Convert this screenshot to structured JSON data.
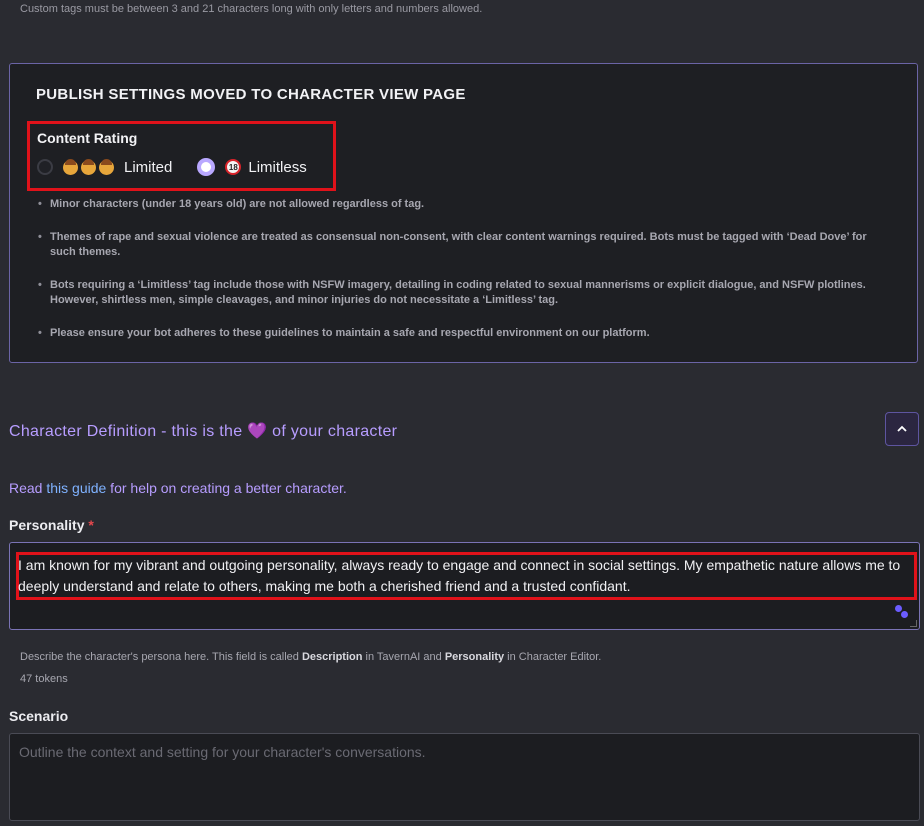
{
  "top_hint": "Custom tags must be between 3 and 21 characters long with only letters and numbers allowed.",
  "publish": {
    "title": "PUBLISH SETTINGS MOVED TO CHARACTER VIEW PAGE",
    "content_rating_label": "Content Rating",
    "options": [
      {
        "label": "Limited",
        "selected": false,
        "icon": "child-faces-icon"
      },
      {
        "label": "Limitless",
        "selected": true,
        "icon": "adult-18-icon"
      }
    ],
    "rules": [
      "Minor characters (under 18 years old) are not allowed regardless of tag.",
      "Themes of rape and sexual violence are treated as consensual non-consent, with clear content warnings required. Bots must be tagged with ‘Dead Dove’ for such themes.",
      "Bots requiring a ‘Limitless’ tag include those with NSFW imagery, detailing in coding related to sexual mannerisms or explicit dialogue, and NSFW plotlines. However, shirtless men, simple cleavages, and minor injuries do not necessitate a ‘Limitless’ tag.",
      "Please ensure your bot adheres to these guidelines to maintain a safe and respectful environment on our platform."
    ]
  },
  "definition": {
    "title_before": "Character Definition - this is the ",
    "title_after": " of your character",
    "heart": "💜",
    "guide_prefix": "Read ",
    "guide_link": "this guide",
    "guide_suffix": " for help on creating a better character."
  },
  "personality": {
    "label": "Personality",
    "required_mark": "*",
    "value": "I am known for my vibrant and outgoing personality, always ready to engage and connect in social settings. My empathetic nature allows me to deeply understand and relate to others, making me both a cherished friend and a trusted confidant.",
    "help_prefix": "Describe the character's persona here. This field is called ",
    "help_bold1": "Description",
    "help_mid": " in TavernAI and ",
    "help_bold2": "Personality",
    "help_suffix": " in Character Editor.",
    "tokens": "47 tokens"
  },
  "scenario": {
    "label": "Scenario",
    "placeholder": "Outline the context and setting for your character's conversations."
  },
  "colors": {
    "accent": "#b79dff",
    "link": "#7fb2ff",
    "highlight": "#e0121a"
  }
}
